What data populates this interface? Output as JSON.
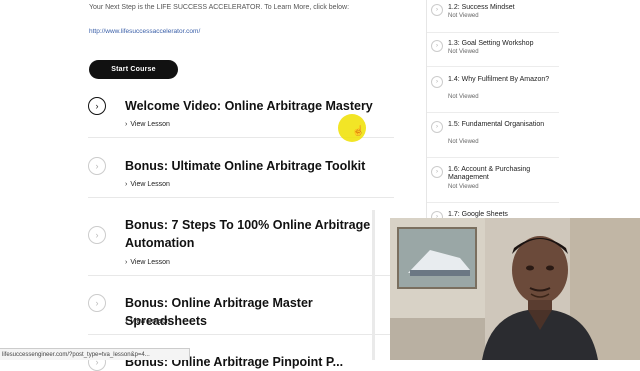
{
  "intro_text": "Your Next Step is the LIFE SUCCESS ACCELERATOR. To Learn More, click below:",
  "intro_link": "http://www.lifesuccessaccelerator.com/",
  "start_button": "Start Course",
  "lessons": [
    {
      "title": "Welcome Video: Online Arbitrage Mastery",
      "view": "View Lesson",
      "icon": "chevron-right-icon"
    },
    {
      "title": "Bonus: Ultimate Online Arbitrage Toolkit",
      "view": "View Lesson",
      "icon": "chevron-right-icon"
    },
    {
      "title": "Bonus: 7 Steps To 100% Online Arbitrage Automation",
      "view": "View Lesson",
      "icon": "chevron-right-icon"
    },
    {
      "title": "Bonus: Online Arbitrage Master Spreadsheets",
      "view": "View Lesson",
      "icon": "chevron-right-icon"
    },
    {
      "title": "Bonus: Online Arbitrage Pinpoint P...",
      "view": "",
      "icon": "chevron-right-icon"
    }
  ],
  "sidebar": {
    "items": [
      {
        "title": "1.2: Success Mindset",
        "status": "Not Viewed"
      },
      {
        "title": "1.3: Goal Setting Workshop",
        "status": "Not Viewed"
      },
      {
        "title": "1.4: Why Fulfilment By Amazon?",
        "status": "Not Viewed"
      },
      {
        "title": "1.5: Fundamental Organisation",
        "status": "Not Viewed"
      },
      {
        "title": "1.6: Account & Purchasing Management",
        "status": "Not Viewed"
      },
      {
        "title": "1.7: Google Sheets",
        "status": ""
      }
    ]
  },
  "status_bar": "lifesuccessengineer.com/?post_type=tva_lesson&p=4...",
  "colors": {
    "accent_button": "#111111",
    "link": "#3a5fa8",
    "cursor_highlight": "#f0e000"
  }
}
